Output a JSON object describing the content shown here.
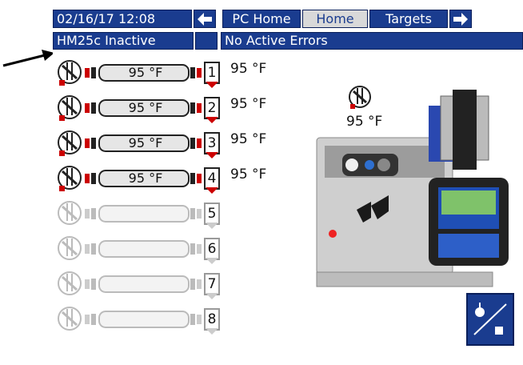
{
  "header": {
    "datetime": "02/16/17 12:08",
    "back_arrow": "🡐",
    "tabs": [
      {
        "label": "PC Home"
      },
      {
        "label": "Home"
      },
      {
        "label": "Targets"
      }
    ],
    "next_arrow": "🡒"
  },
  "status": {
    "system": "HM25c Inactive",
    "errors": "No Active Errors"
  },
  "zones": [
    {
      "id": "1",
      "temp": "95 °F",
      "label": "95 °F",
      "active": true
    },
    {
      "id": "2",
      "temp": "95 °F",
      "label": "95 °F",
      "active": true
    },
    {
      "id": "3",
      "temp": "95 °F",
      "label": "95 °F",
      "active": true
    },
    {
      "id": "4",
      "temp": "95 °F",
      "label": "95 °F",
      "active": true
    },
    {
      "id": "5",
      "temp": "",
      "label": "",
      "active": false
    },
    {
      "id": "6",
      "temp": "",
      "label": "",
      "active": false
    },
    {
      "id": "7",
      "temp": "",
      "label": "",
      "active": false
    },
    {
      "id": "8",
      "temp": "",
      "label": "",
      "active": false
    }
  ],
  "melter": {
    "temp": "95 °F"
  },
  "colors": {
    "accent": "#1a3c8f",
    "active": "#e8e8e8",
    "inactive": "#f5f5f5"
  },
  "icons": {
    "callout": "arrow-icon",
    "heater": "heater-off-icon",
    "machine": "machine-control-icon"
  }
}
